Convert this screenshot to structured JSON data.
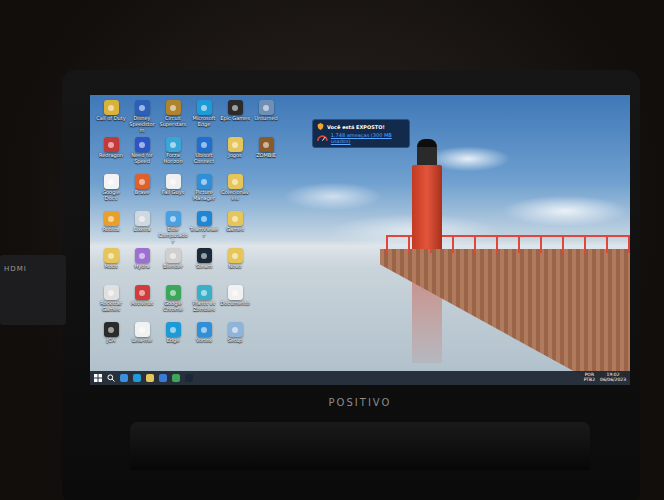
{
  "device": {
    "label": "HDMI"
  },
  "monitor": {
    "brand": "POSITIVO"
  },
  "desktop_rows": [
    [
      {
        "label": "Call of Duty",
        "color": "#d8b23a"
      },
      {
        "label": "Disney Speedstorm",
        "color": "#2c5fb8"
      },
      {
        "label": "Circuit Superstars",
        "color": "#b0842d"
      },
      {
        "label": "Microsoft Edge",
        "color": "#1e9bd7"
      },
      {
        "label": "Epic Games",
        "color": "#2b2b2b"
      },
      {
        "label": "Unturned",
        "color": "#6f8fb5"
      }
    ],
    [
      {
        "label": "Redragon",
        "color": "#c43a3a"
      },
      {
        "label": "Need for Speed",
        "color": "#2d55c8"
      },
      {
        "label": "Forza Horizon",
        "color": "#3aa6d8"
      },
      {
        "label": "Ubisoft Connect",
        "color": "#1f6fd0"
      },
      {
        "label": "Jogos",
        "color": "#e6c55a"
      },
      {
        "label": "ZOMBIE",
        "color": "#8a5a2b"
      }
    ],
    [
      {
        "label": "Google Docs",
        "color": "#f3f3f3"
      },
      {
        "label": "Brave",
        "color": "#e0602a"
      },
      {
        "label": "Fall Guys",
        "color": "#efefef"
      },
      {
        "label": "Picture Manager",
        "color": "#2f8fd8"
      },
      {
        "label": "Colecionáveis",
        "color": "#e6c55a"
      },
      {
        "label": "",
        "color": "#00000000"
      }
    ],
    [
      {
        "label": "Roblox",
        "color": "#e8a02a"
      },
      {
        "label": "Lixeira",
        "color": "#cfd8df"
      },
      {
        "label": "Este Computador",
        "color": "#4aa0e0"
      },
      {
        "label": "TeamViewer",
        "color": "#1f86d6"
      },
      {
        "label": "Games",
        "color": "#e6c55a"
      },
      {
        "label": "",
        "color": "#00000000"
      }
    ],
    [
      {
        "label": "Mods",
        "color": "#e6c55a"
      },
      {
        "label": "Hydra",
        "color": "#9c6fd0"
      },
      {
        "label": "Blender",
        "color": "#d0d0d0"
      },
      {
        "label": "Steam",
        "color": "#1b2838"
      },
      {
        "label": "Novo",
        "color": "#e6c55a"
      },
      {
        "label": "",
        "color": "#00000000"
      }
    ],
    [
      {
        "label": "Rockstar Games",
        "color": "#e0e0e0"
      },
      {
        "label": "Antivírus",
        "color": "#d13b3b"
      },
      {
        "label": "Google Chrome",
        "color": "#3aa75a"
      },
      {
        "label": "Plants vs Zombies",
        "color": "#39b0c9"
      },
      {
        "label": "Documento",
        "color": "#f1f1f1"
      },
      {
        "label": "",
        "color": "#00000000"
      }
    ],
    [
      {
        "label": "JCA",
        "color": "#2b2b2b"
      },
      {
        "label": "Leia-me",
        "color": "#f1f1f1"
      },
      {
        "label": "Edge",
        "color": "#1e9bd7"
      },
      {
        "label": "Vortex",
        "color": "#2f8fd8"
      },
      {
        "label": "Setup",
        "color": "#8fb3d9"
      },
      {
        "label": "",
        "color": "#00000000"
      }
    ]
  ],
  "notification": {
    "title": "Você está EXPOSTO!",
    "link": "1.748 ameaças (300 MB usados)"
  },
  "taskbar": {
    "pinned": [
      {
        "color": "#3a8fe0"
      },
      {
        "color": "#1e9bd7"
      },
      {
        "color": "#e6c55a"
      },
      {
        "color": "#3a7bd5"
      },
      {
        "color": "#3aa75a"
      },
      {
        "color": "#1b2838"
      }
    ],
    "tray": {
      "language": "POR",
      "layout": "PTB2",
      "time": "19:02",
      "date": "06/06/2023"
    }
  }
}
